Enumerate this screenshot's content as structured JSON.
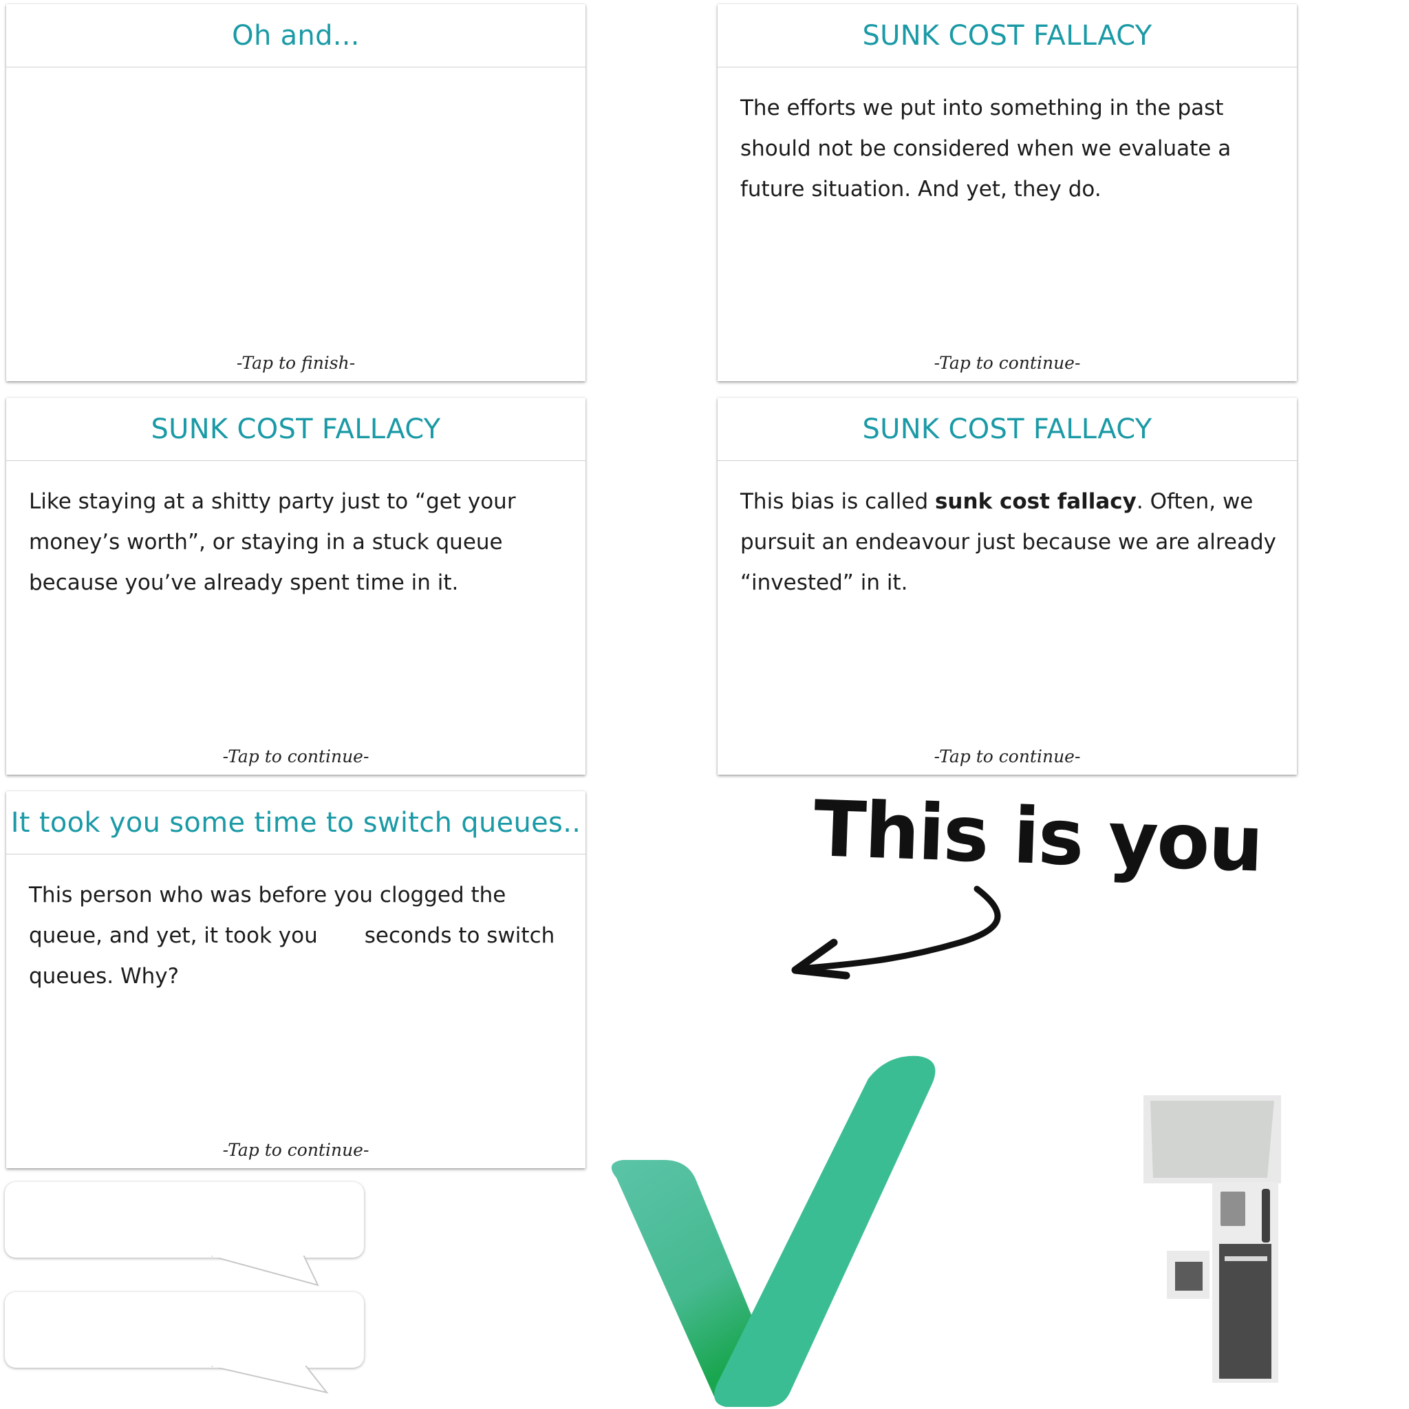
{
  "cards": [
    {
      "title": "Oh and...",
      "body_parts": [],
      "footer": "-Tap to finish-"
    },
    {
      "title": "SUNK COST FALLACY",
      "body": "The efforts we put into something in the past should not be considered when we evaluate a future situation. And yet, they do.",
      "footer": "-Tap to continue-"
    },
    {
      "title": "SUNK COST FALLACY",
      "body": "Like staying at a shitty party just to “get your money’s worth”, or staying in a stuck queue because you’ve already spent time in it.",
      "footer": "-Tap to continue-"
    },
    {
      "title": "SUNK COST FALLACY",
      "body_before": "This bias is called ",
      "body_bold": "sunk cost fallacy",
      "body_after": ". Often, we pursuit an endeavour just because we are already “invested” in it.",
      "footer": "-Tap to continue-"
    },
    {
      "title": "It took you some time to switch queues..",
      "body_before": "This person who was before you clogged the queue, and yet, it took you",
      "body_after": "seconds to switch queues. Why?",
      "footer": "-Tap to continue-"
    }
  ],
  "annotation": {
    "text": "This is you"
  },
  "icons": {
    "checkmark": "checkmark-icon",
    "kiosk": "kiosk-icon",
    "arrow": "curved-arrow-icon"
  },
  "colors": {
    "title": "#1a9aa6",
    "check_dark": "#1fae62",
    "check_light": "#3dbd94"
  }
}
